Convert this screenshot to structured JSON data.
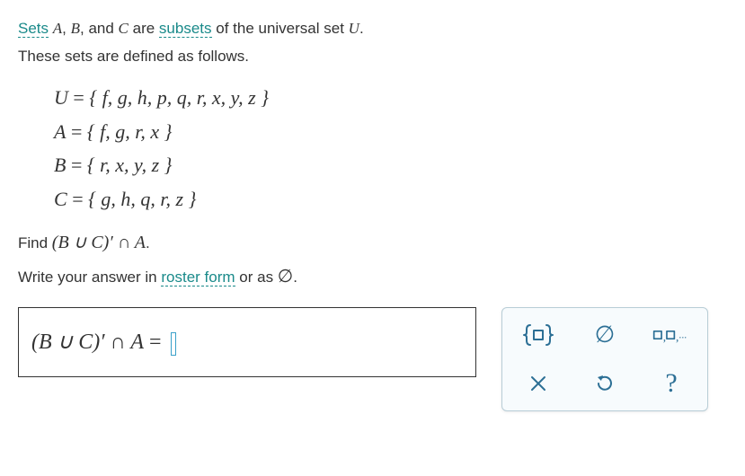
{
  "intro": {
    "prefix": "Sets",
    "var_a": "A",
    "sep1": ", ",
    "var_b": "B",
    "sep2": ", and ",
    "var_c": "C",
    "mid": " are ",
    "link1": "subsets",
    "mid2": " of the universal set ",
    "var_u": "U",
    "end": ".",
    "line2": "These sets are defined as follows."
  },
  "sets": {
    "u_lhs": "U",
    "u_rhs": "{ f, g, h, p, q, r, x, y, z }",
    "a_lhs": "A",
    "a_rhs": "{ f, g, r, x }",
    "b_lhs": "B",
    "b_rhs": "{ r, x, y, z }",
    "c_lhs": "C",
    "c_rhs": "{ g, h, q, r, z }"
  },
  "question": {
    "find_prefix": "Find ",
    "expr": "(B ∪ C)′ ∩ A",
    "find_suffix": ".",
    "write_prefix": "Write your answer in ",
    "link2": "roster form",
    "write_mid": " or as ",
    "empty_sym": "∅",
    "write_end": "."
  },
  "answer": {
    "expr_lhs": "(B ∪ C)′ ∩ A",
    "eq": " = "
  },
  "tools": {
    "roster_hint": "{□}",
    "empty": "∅",
    "list_hint": "□,□,..."
  }
}
